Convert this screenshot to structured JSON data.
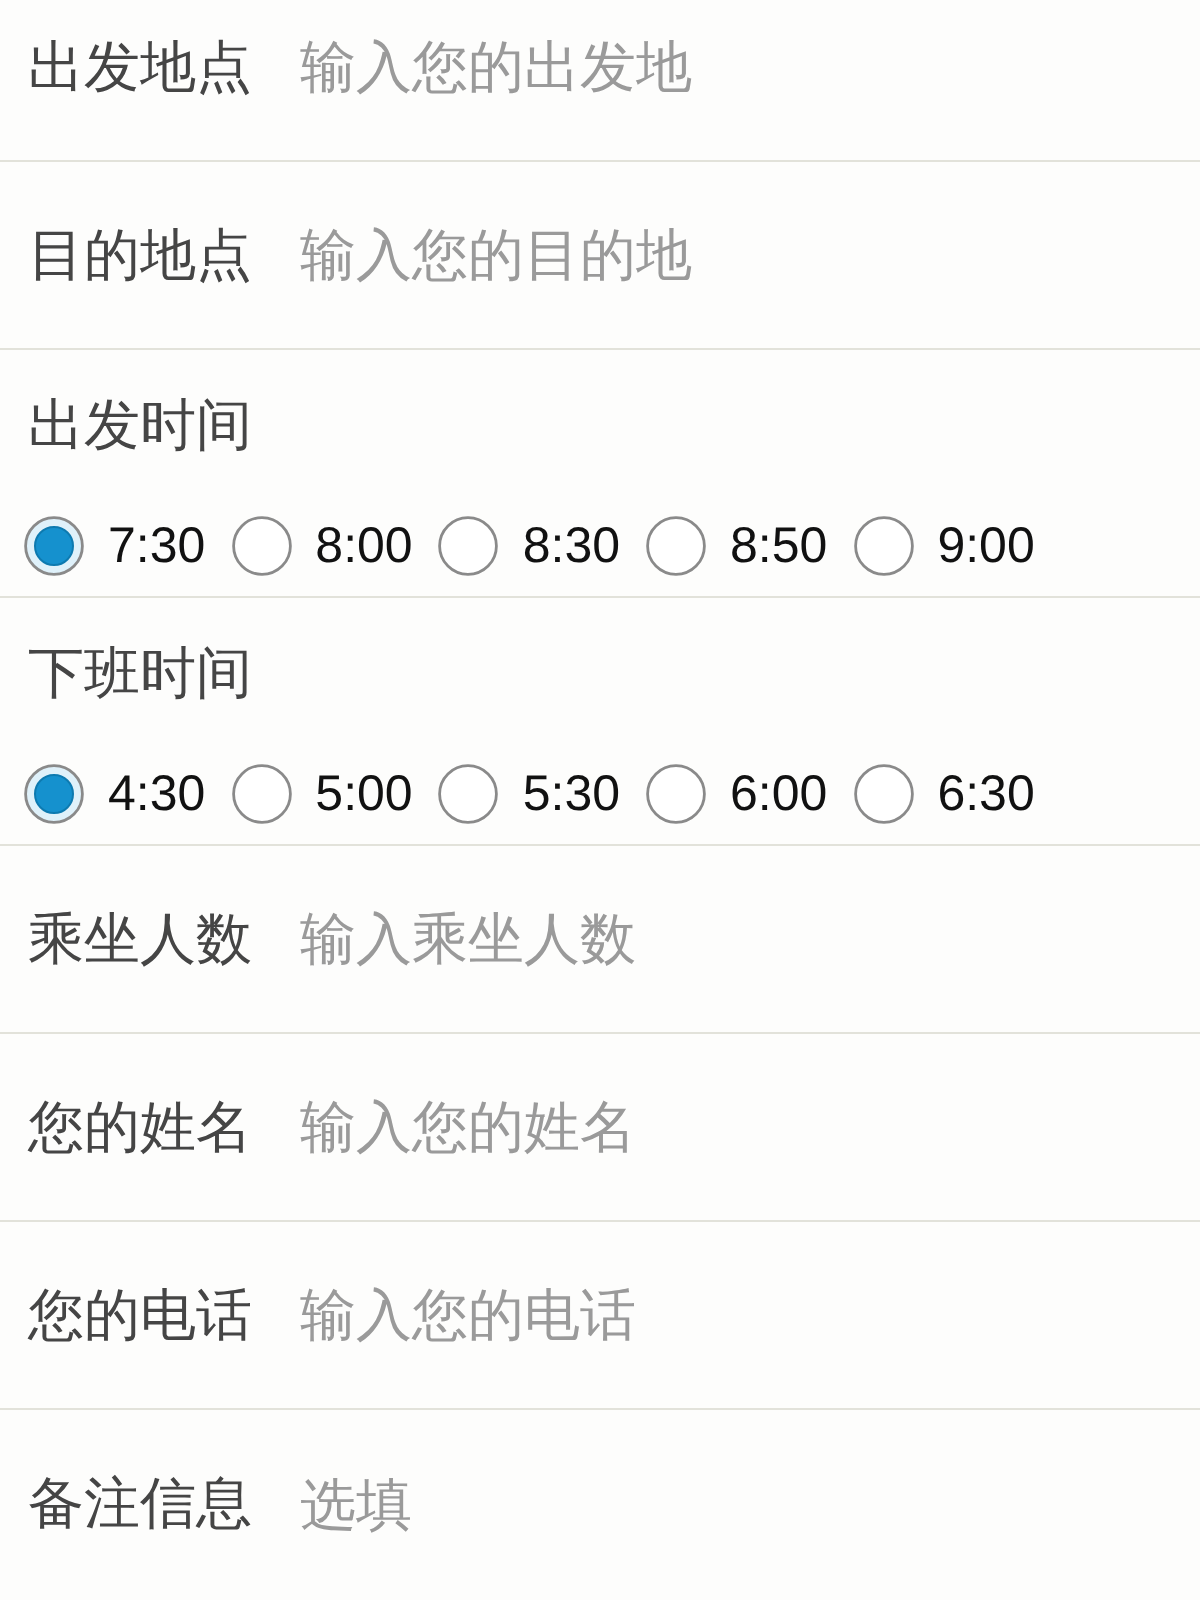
{
  "fields": [
    {
      "kind": "text",
      "label": "出发地点",
      "placeholder": "输入您的出发地"
    },
    {
      "kind": "text",
      "label": "目的地点",
      "placeholder": "输入您的目的地"
    },
    {
      "kind": "radio",
      "label": "出发时间",
      "options": [
        {
          "label": "7:30",
          "selected": true
        },
        {
          "label": "8:00",
          "selected": false
        },
        {
          "label": "8:30",
          "selected": false
        },
        {
          "label": "8:50",
          "selected": false
        },
        {
          "label": "9:00",
          "selected": false
        }
      ]
    },
    {
      "kind": "radio",
      "label": "下班时间",
      "options": [
        {
          "label": "4:30",
          "selected": true
        },
        {
          "label": "5:00",
          "selected": false
        },
        {
          "label": "5:30",
          "selected": false
        },
        {
          "label": "6:00",
          "selected": false
        },
        {
          "label": "6:30",
          "selected": false
        }
      ]
    },
    {
      "kind": "text",
      "label": "乘坐人数",
      "placeholder": "输入乘坐人数"
    },
    {
      "kind": "text",
      "label": "您的姓名",
      "placeholder": "输入您的姓名"
    },
    {
      "kind": "text",
      "label": "您的电话",
      "placeholder": "输入您的电话"
    },
    {
      "kind": "text",
      "label": "备注信息",
      "placeholder": "选填"
    }
  ]
}
